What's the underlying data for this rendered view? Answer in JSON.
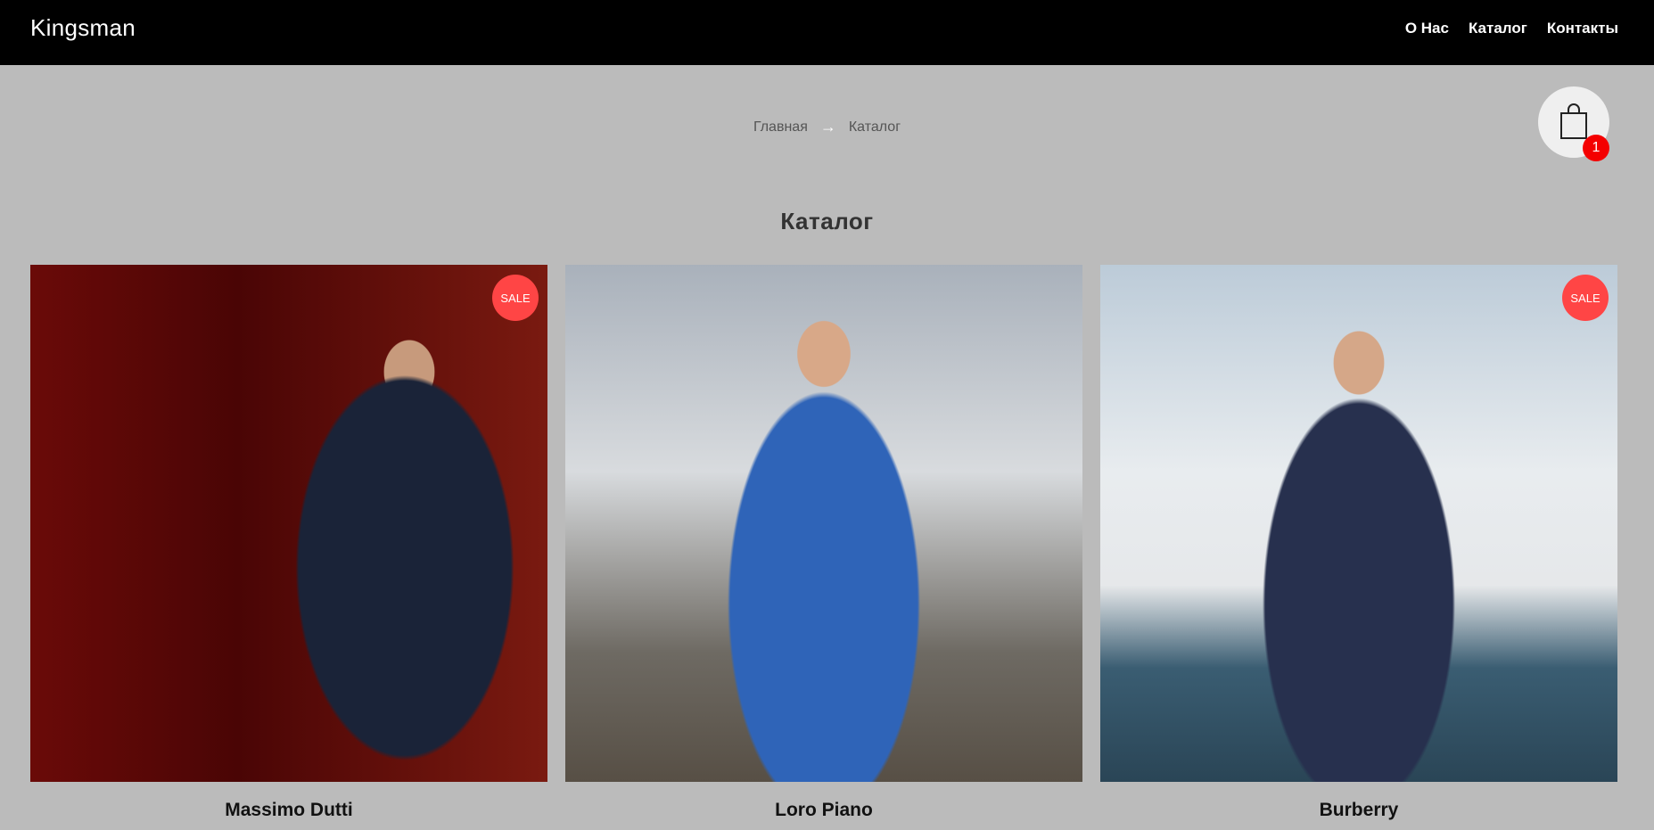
{
  "header": {
    "logo": "Kingsman",
    "nav": [
      {
        "label": "О Нас"
      },
      {
        "label": "Каталог"
      },
      {
        "label": "Контакты"
      }
    ]
  },
  "breadcrumb": {
    "home": "Главная",
    "separator": "→",
    "current": "Каталог"
  },
  "cart": {
    "icon": "shopping-bag-icon",
    "count": "1"
  },
  "page": {
    "title": "Каталог"
  },
  "products": [
    {
      "name": "Massimo Dutti",
      "badge": "SALE"
    },
    {
      "name": "Loro Piano",
      "badge": ""
    },
    {
      "name": "Burberry",
      "badge": "SALE"
    }
  ],
  "colors": {
    "header_bg": "#000000",
    "page_bg": "#bbbbbb",
    "sale_badge": "#ff4545",
    "cart_badge": "#f40000"
  }
}
